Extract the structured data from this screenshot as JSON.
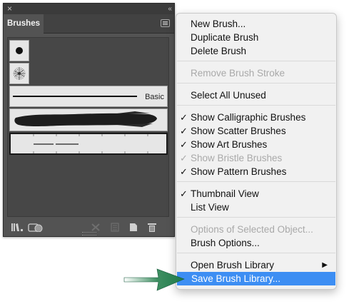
{
  "panel": {
    "tab_label": "Brushes",
    "close_glyph": "×",
    "collapse_glyph": "‹‹",
    "basic_label": "Basic",
    "menu_icon": "hamburger-icon",
    "bottom_icons": [
      "brush-libraries-icon",
      "libraries-panel-icon",
      "remove-brush-stroke-icon",
      "brush-options-icon",
      "new-brush-icon",
      "delete-brush-icon"
    ]
  },
  "menu": {
    "items": [
      {
        "label": "New Brush...",
        "enabled": true,
        "checked": false
      },
      {
        "label": "Duplicate Brush",
        "enabled": true,
        "checked": false
      },
      {
        "label": "Delete Brush",
        "enabled": true,
        "checked": false
      },
      {
        "label": "Remove Brush Stroke",
        "enabled": false,
        "checked": false
      },
      {
        "label": "Select All Unused",
        "enabled": true,
        "checked": false
      },
      {
        "label": "Show Calligraphic Brushes",
        "enabled": true,
        "checked": true
      },
      {
        "label": "Show Scatter Brushes",
        "enabled": true,
        "checked": true
      },
      {
        "label": "Show Art Brushes",
        "enabled": true,
        "checked": true
      },
      {
        "label": "Show Bristle Brushes",
        "enabled": false,
        "checked": true
      },
      {
        "label": "Show Pattern Brushes",
        "enabled": true,
        "checked": true
      },
      {
        "label": "Thumbnail View",
        "enabled": true,
        "checked": true
      },
      {
        "label": "List View",
        "enabled": true,
        "checked": false
      },
      {
        "label": "Options of Selected Object...",
        "enabled": false,
        "checked": false
      },
      {
        "label": "Brush Options...",
        "enabled": true,
        "checked": false
      },
      {
        "label": "Open Brush Library",
        "enabled": true,
        "checked": false,
        "submenu": true
      },
      {
        "label": "Save Brush Library...",
        "enabled": true,
        "checked": false,
        "highlighted": true
      }
    ],
    "check_glyph": "✓",
    "submenu_glyph": "▶",
    "highlight_color": "#3d8ef3"
  },
  "annotation": {
    "arrow_color": "#1e7a4a"
  }
}
